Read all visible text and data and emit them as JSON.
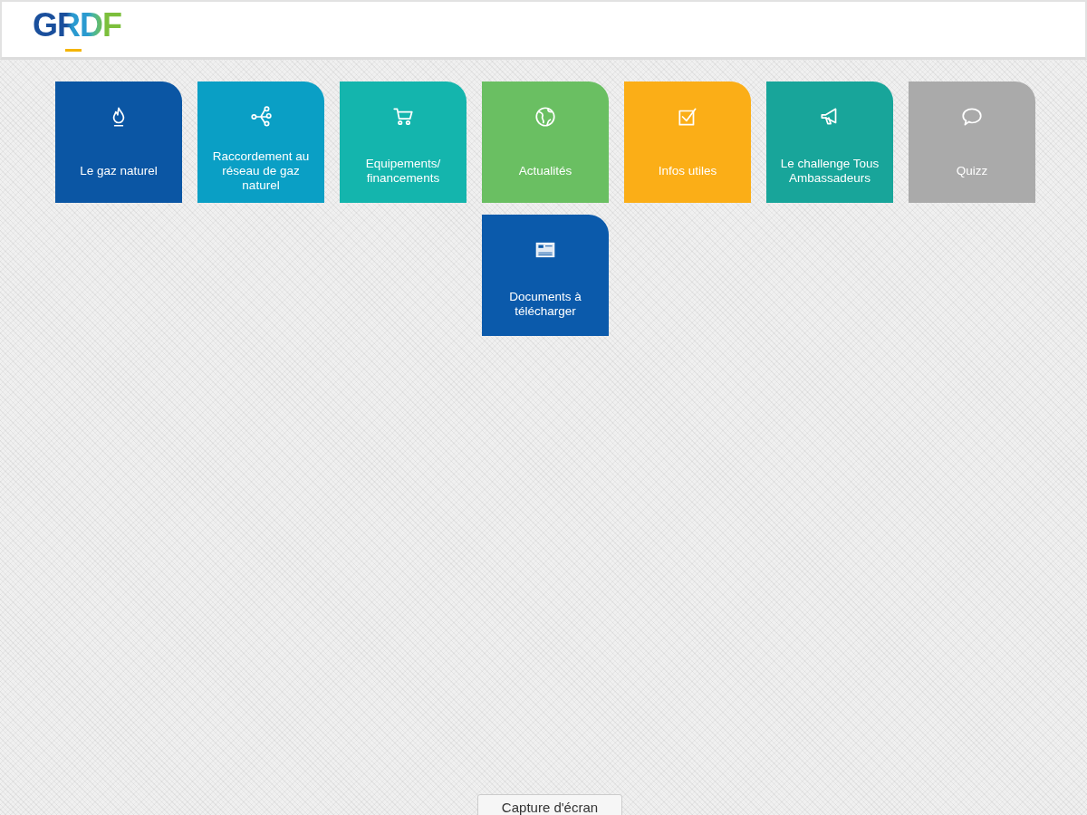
{
  "header": {
    "logo": "GRDF"
  },
  "tiles": [
    {
      "label": "Le gaz naturel",
      "color": "#0b56a4"
    },
    {
      "label": "Raccordement au réseau de gaz naturel",
      "color": "#0a9fc5"
    },
    {
      "label": "Equipements/ financements",
      "color": "#14b5ad"
    },
    {
      "label": "Actualités",
      "color": "#6abf62"
    },
    {
      "label": "Infos utiles",
      "color": "#fbae17"
    },
    {
      "label": "Le challenge Tous Ambassadeurs",
      "color": "#18a59a"
    },
    {
      "label": "Quizz",
      "color": "#aaaaaa"
    },
    {
      "label": "Documents à télécharger",
      "color": "#0b5aab"
    }
  ],
  "tooltip": "Capture d'écran"
}
